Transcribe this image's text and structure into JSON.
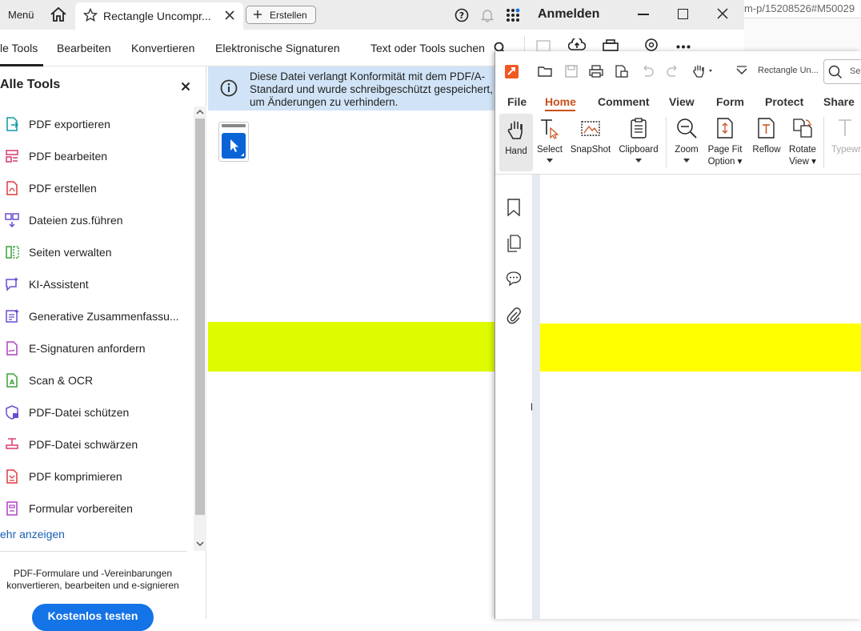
{
  "acrobat": {
    "titlebar": {
      "menu_label": "Menü",
      "tab_title": "Rectangle Uncompr...",
      "create_label": "Erstellen",
      "signin_label": "Anmelden"
    },
    "nav_tabs": [
      "le Tools",
      "Bearbeiten",
      "Konvertieren",
      "Elektronische Signaturen"
    ],
    "search_label": "Text oder Tools suchen",
    "sidebar": {
      "title": "Alle Tools",
      "items": [
        {
          "label": "PDF exportieren",
          "icon": "export-pdf-icon",
          "color": "#0d9ba4"
        },
        {
          "label": "PDF bearbeiten",
          "icon": "edit-pdf-icon",
          "color": "#d53a6f"
        },
        {
          "label": "PDF erstellen",
          "icon": "create-pdf-icon",
          "color": "#e0393e"
        },
        {
          "label": "Dateien zus.führen",
          "icon": "combine-files-icon",
          "color": "#6b4bd1"
        },
        {
          "label": "Seiten verwalten",
          "icon": "organize-pages-icon",
          "color": "#3aa13a"
        },
        {
          "label": "KI-Assistent",
          "icon": "ai-assistant-icon",
          "color": "#6b4bd1"
        },
        {
          "label": "Generative Zusammenfassu...",
          "icon": "generative-summary-icon",
          "color": "#6b4bd1"
        },
        {
          "label": "E-Signaturen anfordern",
          "icon": "request-esign-icon",
          "color": "#b03fc7"
        },
        {
          "label": "Scan & OCR",
          "icon": "scan-ocr-icon",
          "color": "#3aa13a"
        },
        {
          "label": "PDF-Datei schützen",
          "icon": "protect-pdf-icon",
          "color": "#6b4bd1"
        },
        {
          "label": "PDF-Datei schwärzen",
          "icon": "redact-pdf-icon",
          "color": "#d53a6f"
        },
        {
          "label": "PDF komprimieren",
          "icon": "compress-pdf-icon",
          "color": "#e0393e"
        },
        {
          "label": "Formular vorbereiten",
          "icon": "prepare-form-icon",
          "color": "#b03fc7"
        }
      ],
      "more_label": "ehr anzeigen",
      "promo_text": "PDF-Formulare und -Vereinbarungen konvertieren, bearbeiten und e-signieren",
      "promo_button": "Kostenlos testen"
    },
    "notice": "Diese Datei verlangt Konformität mit dem PDF/A-Standard und wurde schreibgeschützt gespeichert, um Änderungen zu verhindern.",
    "highlight_color": "#dffb00"
  },
  "browser": {
    "url_fragment": "m-p/15208526#M50029"
  },
  "foxit": {
    "doc_title": "Rectangle Un...",
    "search_placeholder": "Search",
    "menu": [
      "File",
      "Home",
      "Comment",
      "View",
      "Form",
      "Protect",
      "Share"
    ],
    "active_menu": "Home",
    "accent_color": "#c8511b",
    "ribbon": {
      "hand": "Hand",
      "select": "Select",
      "snapshot": "SnapShot",
      "clipboard": "Clipboard",
      "zoom": "Zoom",
      "page_fit_1": "Page Fit",
      "page_fit_2": "Option",
      "reflow": "Reflow",
      "rotate_1": "Rotate",
      "rotate_2": "View",
      "typewriter": "Typewr"
    },
    "highlight_color": "#ffff00"
  }
}
